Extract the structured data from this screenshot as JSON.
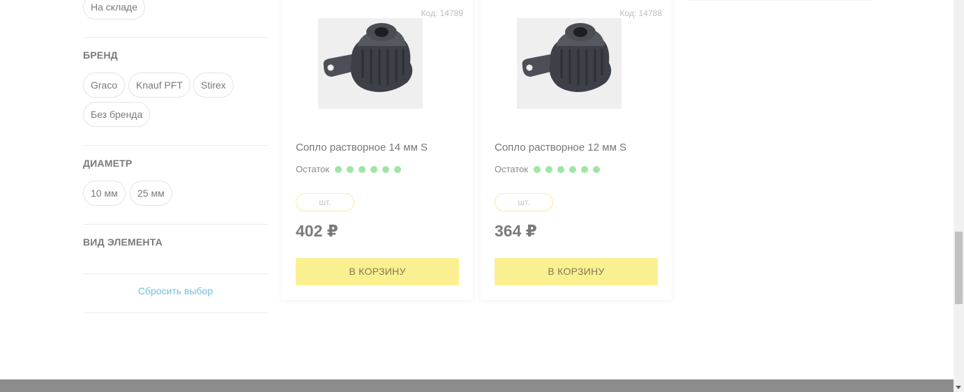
{
  "filters": {
    "stock_chip": "На складе",
    "brand": {
      "title": "БРЕНД",
      "options": [
        "Graco",
        "Knauf PFT",
        "Stirex",
        "Без бренда"
      ]
    },
    "diameter": {
      "title": "ДИАМЕТР",
      "options": [
        "10 мм",
        "25 мм"
      ]
    },
    "element_type": {
      "title": "ВИД ЭЛЕМЕНТА"
    },
    "reset_label": "Сбросить выбор"
  },
  "products": [
    {
      "code": "Код: 14789",
      "title": "Сопло растворное 14 мм S",
      "stock_label": "Остаток",
      "stock_level": 6,
      "qty_placeholder": "шт.",
      "price": "402 ₽",
      "buy_label": "В КОРЗИНУ"
    },
    {
      "code": "Код: 14788",
      "title": "Сопло растворное 12 мм S",
      "stock_label": "Остаток",
      "stock_level": 6,
      "qty_placeholder": "шт.",
      "price": "364 ₽",
      "buy_label": "В КОРЗИНУ"
    }
  ],
  "colors": {
    "accent_button": "#fbf08f",
    "stock_dot": "#9ee6a5",
    "reset_link": "#6fc1df"
  }
}
